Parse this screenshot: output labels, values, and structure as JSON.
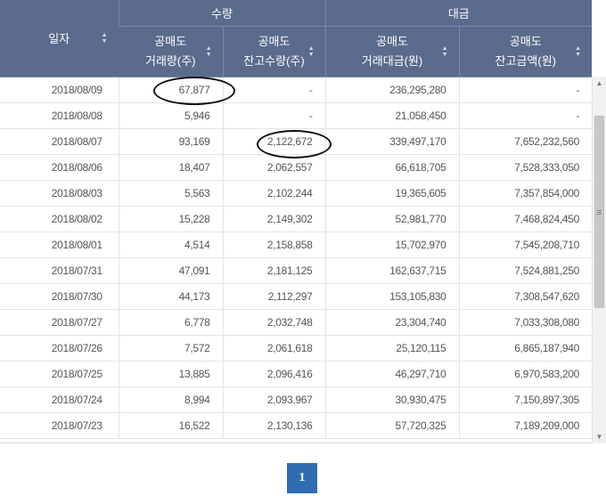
{
  "header": {
    "date": "일자",
    "group_volume": "수량",
    "group_amount": "대금",
    "columns": [
      {
        "line1": "공매도",
        "line2": "거래량(주)"
      },
      {
        "line1": "공매도",
        "line2": "잔고수량(주)"
      },
      {
        "line1": "공매도",
        "line2": "거래대금(원)"
      },
      {
        "line1": "공매도",
        "line2": "잔고금액(원)"
      }
    ],
    "sort_icon": "sort-updown-icon"
  },
  "rows": [
    {
      "date": "2018/08/09",
      "v1": "67,877",
      "v2": "-",
      "v3": "236,295,280",
      "v4": "-"
    },
    {
      "date": "2018/08/08",
      "v1": "5,946",
      "v2": "-",
      "v3": "21,058,450",
      "v4": "-"
    },
    {
      "date": "2018/08/07",
      "v1": "93,169",
      "v2": "2,122,672",
      "v3": "339,497,170",
      "v4": "7,652,232,560"
    },
    {
      "date": "2018/08/06",
      "v1": "18,407",
      "v2": "2,062,557",
      "v3": "66,618,705",
      "v4": "7,528,333,050"
    },
    {
      "date": "2018/08/03",
      "v1": "5,563",
      "v2": "2,102,244",
      "v3": "19,365,605",
      "v4": "7,357,854,000"
    },
    {
      "date": "2018/08/02",
      "v1": "15,228",
      "v2": "2,149,302",
      "v3": "52,981,770",
      "v4": "7,468,824,450"
    },
    {
      "date": "2018/08/01",
      "v1": "4,514",
      "v2": "2,158,858",
      "v3": "15,702,970",
      "v4": "7,545,208,710"
    },
    {
      "date": "2018/07/31",
      "v1": "47,091",
      "v2": "2,181,125",
      "v3": "162,637,715",
      "v4": "7,524,881,250"
    },
    {
      "date": "2018/07/30",
      "v1": "44,173",
      "v2": "2,112,297",
      "v3": "153,105,830",
      "v4": "7,308,547,620"
    },
    {
      "date": "2018/07/27",
      "v1": "6,778",
      "v2": "2,032,748",
      "v3": "23,304,740",
      "v4": "7,033,308,080"
    },
    {
      "date": "2018/07/26",
      "v1": "7,572",
      "v2": "2,061,618",
      "v3": "25,120,115",
      "v4": "6,865,187,940"
    },
    {
      "date": "2018/07/25",
      "v1": "13,885",
      "v2": "2,096,416",
      "v3": "46,297,710",
      "v4": "6,970,583,200"
    },
    {
      "date": "2018/07/24",
      "v1": "8,994",
      "v2": "2,093,967",
      "v3": "30,930,475",
      "v4": "7,150,897,305"
    },
    {
      "date": "2018/07/23",
      "v1": "16,522",
      "v2": "2,130,136",
      "v3": "57,720,325",
      "v4": "7,189,209,000"
    }
  ],
  "pagination": {
    "current": "1"
  },
  "colors": {
    "header_bg": "#5a6b8c",
    "page_active": "#2e6db4",
    "annotation": "#111111"
  }
}
